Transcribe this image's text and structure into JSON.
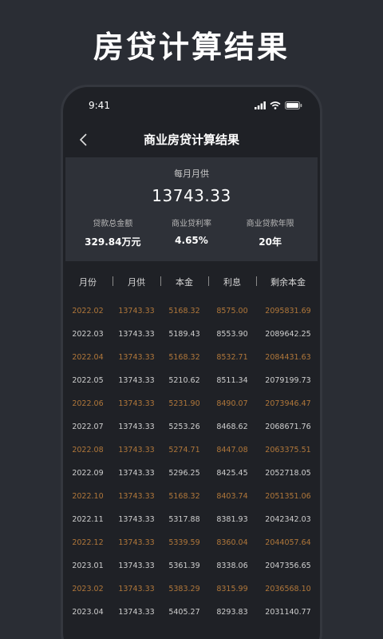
{
  "promo": {
    "title": "房贷计算结果"
  },
  "status_bar": {
    "time": "9:41"
  },
  "nav": {
    "title": "商业房贷计算结果"
  },
  "summary": {
    "monthly_label": "每月月供",
    "monthly_value": "13743.33",
    "stats": [
      {
        "label": "贷款总金额",
        "value": "329.84万元"
      },
      {
        "label": "商业贷利率",
        "value": "4.65%"
      },
      {
        "label": "商业贷款年限",
        "value": "20年"
      }
    ]
  },
  "table": {
    "headers": [
      "月份",
      "月供",
      "本金",
      "利息",
      "剩余本金"
    ],
    "rows": [
      [
        "2022.02",
        "13743.33",
        "5168.32",
        "8575.00",
        "2095831.69"
      ],
      [
        "2022.03",
        "13743.33",
        "5189.43",
        "8553.90",
        "2089642.25"
      ],
      [
        "2022.04",
        "13743.33",
        "5168.32",
        "8532.71",
        "2084431.63"
      ],
      [
        "2022.05",
        "13743.33",
        "5210.62",
        "8511.34",
        "2079199.73"
      ],
      [
        "2022.06",
        "13743.33",
        "5231.90",
        "8490.07",
        "2073946.47"
      ],
      [
        "2022.07",
        "13743.33",
        "5253.26",
        "8468.62",
        "2068671.76"
      ],
      [
        "2022.08",
        "13743.33",
        "5274.71",
        "8447.08",
        "2063375.51"
      ],
      [
        "2022.09",
        "13743.33",
        "5296.25",
        "8425.45",
        "2052718.05"
      ],
      [
        "2022.10",
        "13743.33",
        "5168.32",
        "8403.74",
        "2051351.06"
      ],
      [
        "2022.11",
        "13743.33",
        "5317.88",
        "8381.93",
        "2042342.03"
      ],
      [
        "2022.12",
        "13743.33",
        "5339.59",
        "8360.04",
        "2044057.64"
      ],
      [
        "2023.01",
        "13743.33",
        "5361.39",
        "8338.06",
        "2047356.65"
      ],
      [
        "2023.02",
        "13743.33",
        "5383.29",
        "8315.99",
        "2036568.10"
      ],
      [
        "2023.04",
        "13743.33",
        "5405.27",
        "8293.83",
        "2031140.77"
      ]
    ]
  },
  "colors": {
    "background": "#2a2d34",
    "phone": "#1f2126",
    "summary_panel": "#2e3138",
    "highlight_row": "#b0773a",
    "normal_row": "#cfcfcf"
  },
  "icons": {
    "back": "chevron-left-icon",
    "signal": "signal-icon",
    "wifi": "wifi-icon",
    "battery": "battery-icon"
  }
}
